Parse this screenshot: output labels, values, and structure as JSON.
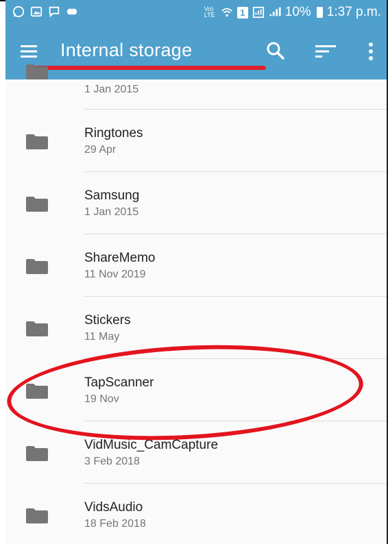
{
  "status_bar": {
    "notification_icons": [
      "whatsapp-icon",
      "gallery-icon",
      "message-icon",
      "game-icon"
    ],
    "network_label": "Vo) LTE",
    "sim_badge": "1",
    "battery_text": "10%",
    "time": "1:37 p.m."
  },
  "toolbar": {
    "title": "Internal storage",
    "actions": [
      "menu-icon",
      "search-icon",
      "sort-icon",
      "more-vert-icon"
    ]
  },
  "files": [
    {
      "name": "",
      "date": "1 Jan 2015"
    },
    {
      "name": "Ringtones",
      "date": "29 Apr"
    },
    {
      "name": "Samsung",
      "date": "1 Jan 2015"
    },
    {
      "name": "ShareMemo",
      "date": "11 Nov 2019"
    },
    {
      "name": "Stickers",
      "date": "11 May"
    },
    {
      "name": "TapScanner",
      "date": "19 Nov"
    },
    {
      "name": "VidMusic_CamCapture",
      "date": "3 Feb 2018"
    },
    {
      "name": "VidsAudio",
      "date": "18 Feb 2018"
    }
  ],
  "colors": {
    "toolbar": "#4fa0cc",
    "annotation": "#e3141e",
    "folder": "#757575"
  }
}
